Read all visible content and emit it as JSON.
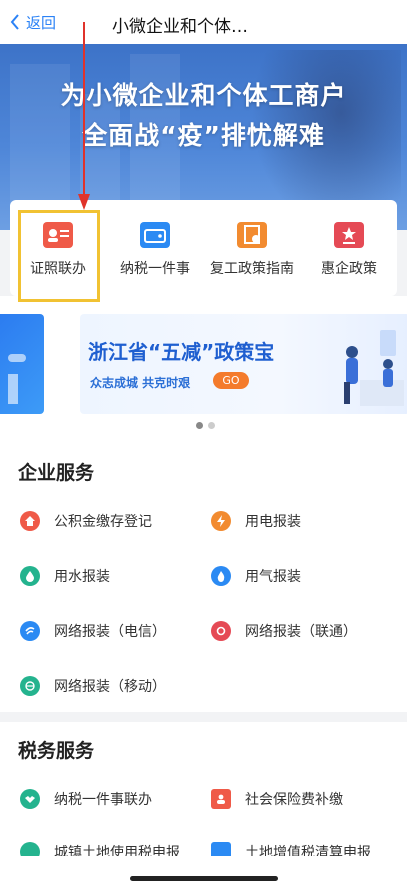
{
  "nav": {
    "back_label": "返回",
    "title": "小微企业和个体…"
  },
  "hero": {
    "line1": "为小微企业和个体工商户",
    "line2": "全面战“疫”排忧解难"
  },
  "quick_links": [
    {
      "label": "证照联办",
      "icon": "id-card-icon",
      "color": "#ef5a48"
    },
    {
      "label": "纳税一件事",
      "icon": "wallet-icon",
      "color": "#2b8af3"
    },
    {
      "label": "复工政策指南",
      "icon": "certificate-icon",
      "color": "#f28b30"
    },
    {
      "label": "惠企政策",
      "icon": "document-star-icon",
      "color": "#e54a55"
    }
  ],
  "banner": {
    "title": "浙江省“五减”政策宝",
    "subtitle": "众志成城  共克时艰",
    "go_label": "GO"
  },
  "enterprise": {
    "title": "企业服务",
    "items": [
      {
        "label": "公积金缴存登记",
        "icon": "house-icon",
        "color": "#ef5a48"
      },
      {
        "label": "用电报装",
        "icon": "lightning-icon",
        "color": "#f28b30"
      },
      {
        "label": "用水报装",
        "icon": "water-drop-icon",
        "color": "#24b38e"
      },
      {
        "label": "用气报装",
        "icon": "flame-icon",
        "color": "#2b8af3"
      },
      {
        "label": "网络报装（电信）",
        "icon": "telecom-icon",
        "color": "#2b8af3"
      },
      {
        "label": "网络报装（联通）",
        "icon": "unicom-icon",
        "color": "#e54a55"
      },
      {
        "label": "网络报装（移动）",
        "icon": "mobile-icon",
        "color": "#24b38e"
      }
    ]
  },
  "tax": {
    "title": "税务服务",
    "items": [
      {
        "label": "纳税一件事联办",
        "icon": "handshake-icon",
        "color": "#24b38e"
      },
      {
        "label": "社会保险费补缴",
        "icon": "insurance-icon",
        "color": "#ef5a48"
      },
      {
        "label": "城镇土地使用税申报",
        "icon": "land-icon",
        "color": "#24b38e"
      },
      {
        "label": "土地增值税清算申报",
        "icon": "land-tax-icon",
        "color": "#2b8af3"
      }
    ]
  }
}
